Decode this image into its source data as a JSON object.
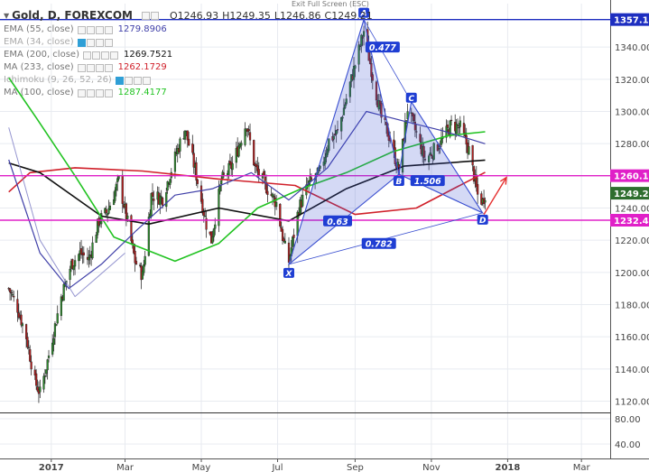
{
  "symbol_title": "Gold, D, FOREXCOM",
  "ohlc": {
    "open": "O1246.93",
    "high": "H1249.35",
    "low": "L1246.86",
    "close": "C1249.21"
  },
  "exit_full_screen": "Exit Full Screen (ESC)",
  "indicators": [
    {
      "name": "EMA (55, close)",
      "value": "1279.8906",
      "color": "#3f3fa8",
      "dim": false
    },
    {
      "name": "EMA (34, close)",
      "value": "",
      "color": "#999999",
      "dim": true
    },
    {
      "name": "EMA (200, close)",
      "value": "1269.7521",
      "color": "#111111",
      "dim": false
    },
    {
      "name": "MA (233, close)",
      "value": "1262.1729",
      "color": "#d0202a",
      "dim": false
    },
    {
      "name": "Ichimoku (9, 26, 52, 26)",
      "value": "",
      "color": "#999999",
      "dim": true
    },
    {
      "name": "MA (100, close)",
      "value": "1287.4177",
      "color": "#22c322",
      "dim": false
    }
  ],
  "chart_data": {
    "type": "candlestick",
    "instrument": "Gold",
    "timeframe": "D",
    "ylim": [
      1113,
      1367
    ],
    "yticks": [
      1120,
      1140,
      1160,
      1180,
      1200,
      1220,
      1240,
      1260,
      1280,
      1300,
      1320,
      1340
    ],
    "xticks": [
      "2017",
      "Mar",
      "May",
      "Jul",
      "Sep",
      "Nov",
      "2018",
      "Mar"
    ],
    "price_labels": [
      {
        "label": "1357.10",
        "value": 1357.1,
        "color": "#1d2ec0"
      },
      {
        "label": "1260.10",
        "value": 1260.1,
        "color": "#e020c8"
      },
      {
        "label": "1249.21",
        "value": 1249.21,
        "color": "#2e6e2e"
      },
      {
        "label": "1232.43",
        "value": 1232.43,
        "color": "#e020c8"
      }
    ],
    "hlines": [
      {
        "value": 1357.1,
        "color": "#1d2ec0"
      },
      {
        "value": 1260.1,
        "color": "#e020c8"
      },
      {
        "value": 1232.43,
        "color": "#e020c8"
      }
    ],
    "lower_pane_ticks": [
      {
        "label": "80.00",
        "value": 80
      },
      {
        "label": "40.00",
        "value": 40
      }
    ],
    "pattern": {
      "points": [
        {
          "label": "X",
          "date": "2017-07-10",
          "price": 1205
        },
        {
          "label": "A",
          "date": "2017-09-08",
          "price": 1357.1
        },
        {
          "label": "B",
          "date": "2017-10-06",
          "price": 1261
        },
        {
          "label": "C",
          "date": "2017-10-16",
          "price": 1306
        },
        {
          "label": "D",
          "date": "2017-12-12",
          "price": 1237
        }
      ],
      "ratios": [
        {
          "label": "0.477",
          "date": "2017-09-23",
          "price": 1340
        },
        {
          "label": "1.506",
          "date": "2017-10-29",
          "price": 1257
        },
        {
          "label": "0.63",
          "date": "2017-08-18",
          "price": 1232
        },
        {
          "label": "0.782",
          "date": "2017-09-20",
          "price": 1218
        }
      ]
    },
    "forecast_arrow": {
      "from": {
        "date": "2017-12-13",
        "price": 1236
      },
      "to": {
        "date": "2017-12-31",
        "price": 1259
      },
      "color": "#e53030"
    },
    "series_price": [
      [
        "2016-11-28",
        1190
      ],
      [
        "2016-12-05",
        1178
      ],
      [
        "2016-12-12",
        1160
      ],
      [
        "2016-12-19",
        1132
      ],
      [
        "2016-12-23",
        1125
      ],
      [
        "2016-12-29",
        1145
      ],
      [
        "2017-01-09",
        1185
      ],
      [
        "2017-01-17",
        1205
      ],
      [
        "2017-01-24",
        1212
      ],
      [
        "2017-01-31",
        1208
      ],
      [
        "2017-02-08",
        1232
      ],
      [
        "2017-02-15",
        1238
      ],
      [
        "2017-02-24",
        1257
      ],
      [
        "2017-03-02",
        1235
      ],
      [
        "2017-03-09",
        1207
      ],
      [
        "2017-03-15",
        1198
      ],
      [
        "2017-03-22",
        1248
      ],
      [
        "2017-03-31",
        1246
      ],
      [
        "2017-04-11",
        1274
      ],
      [
        "2017-04-18",
        1289
      ],
      [
        "2017-04-26",
        1264
      ],
      [
        "2017-05-05",
        1230
      ],
      [
        "2017-05-09",
        1220
      ],
      [
        "2017-05-17",
        1257
      ],
      [
        "2017-05-26",
        1267
      ],
      [
        "2017-06-06",
        1293
      ],
      [
        "2017-06-13",
        1265
      ],
      [
        "2017-06-22",
        1253
      ],
      [
        "2017-06-30",
        1243
      ],
      [
        "2017-07-06",
        1218
      ],
      [
        "2017-07-10",
        1207
      ],
      [
        "2017-07-18",
        1240
      ],
      [
        "2017-07-26",
        1255
      ],
      [
        "2017-08-04",
        1262
      ],
      [
        "2017-08-11",
        1282
      ],
      [
        "2017-08-18",
        1287
      ],
      [
        "2017-08-29",
        1320
      ],
      [
        "2017-09-08",
        1350
      ],
      [
        "2017-09-15",
        1322
      ],
      [
        "2017-09-22",
        1296
      ],
      [
        "2017-09-29",
        1283
      ],
      [
        "2017-10-06",
        1262
      ],
      [
        "2017-10-13",
        1302
      ],
      [
        "2017-10-20",
        1286
      ],
      [
        "2017-10-27",
        1270
      ],
      [
        "2017-11-03",
        1276
      ],
      [
        "2017-11-10",
        1283
      ],
      [
        "2017-11-17",
        1292
      ],
      [
        "2017-11-24",
        1290
      ],
      [
        "2017-12-01",
        1276
      ],
      [
        "2017-12-08",
        1248
      ],
      [
        "2017-12-12",
        1244
      ],
      [
        "2017-12-14",
        1249
      ]
    ],
    "series_ema55": [
      [
        "2016-11-28",
        1270
      ],
      [
        "2016-12-23",
        1212
      ],
      [
        "2017-01-15",
        1190
      ],
      [
        "2017-02-10",
        1205
      ],
      [
        "2017-03-10",
        1226
      ],
      [
        "2017-04-10",
        1248
      ],
      [
        "2017-05-10",
        1252
      ],
      [
        "2017-06-10",
        1262
      ],
      [
        "2017-07-10",
        1245
      ],
      [
        "2017-08-10",
        1265
      ],
      [
        "2017-09-10",
        1300
      ],
      [
        "2017-10-10",
        1294
      ],
      [
        "2017-11-10",
        1288
      ],
      [
        "2017-12-14",
        1279.9
      ]
    ],
    "series_ema200": [
      [
        "2016-11-28",
        1268
      ],
      [
        "2016-12-23",
        1262
      ],
      [
        "2017-02-10",
        1235
      ],
      [
        "2017-03-20",
        1230
      ],
      [
        "2017-05-15",
        1240
      ],
      [
        "2017-07-10",
        1232
      ],
      [
        "2017-08-25",
        1252
      ],
      [
        "2017-10-10",
        1266
      ],
      [
        "2017-12-14",
        1269.8
      ]
    ],
    "series_ma233": [
      [
        "2016-11-28",
        1250
      ],
      [
        "2016-12-15",
        1262
      ],
      [
        "2017-01-20",
        1265
      ],
      [
        "2017-03-15",
        1263
      ],
      [
        "2017-05-15",
        1258
      ],
      [
        "2017-07-15",
        1254
      ],
      [
        "2017-09-01",
        1236
      ],
      [
        "2017-10-20",
        1240
      ],
      [
        "2017-12-14",
        1262.2
      ]
    ],
    "series_ma100": [
      [
        "2016-11-28",
        1321
      ],
      [
        "2016-12-20",
        1296
      ],
      [
        "2017-01-20",
        1260
      ],
      [
        "2017-02-20",
        1222
      ],
      [
        "2017-04-10",
        1207
      ],
      [
        "2017-05-15",
        1218
      ],
      [
        "2017-06-15",
        1240
      ],
      [
        "2017-07-20",
        1252
      ],
      [
        "2017-08-25",
        1262
      ],
      [
        "2017-10-01",
        1275
      ],
      [
        "2017-11-15",
        1285
      ],
      [
        "2017-12-14",
        1287.4
      ]
    ],
    "series_ema55_faded": [
      [
        "2016-11-28",
        1290
      ],
      [
        "2016-12-23",
        1220
      ],
      [
        "2017-01-20",
        1185
      ],
      [
        "2017-03-01",
        1212
      ]
    ]
  }
}
